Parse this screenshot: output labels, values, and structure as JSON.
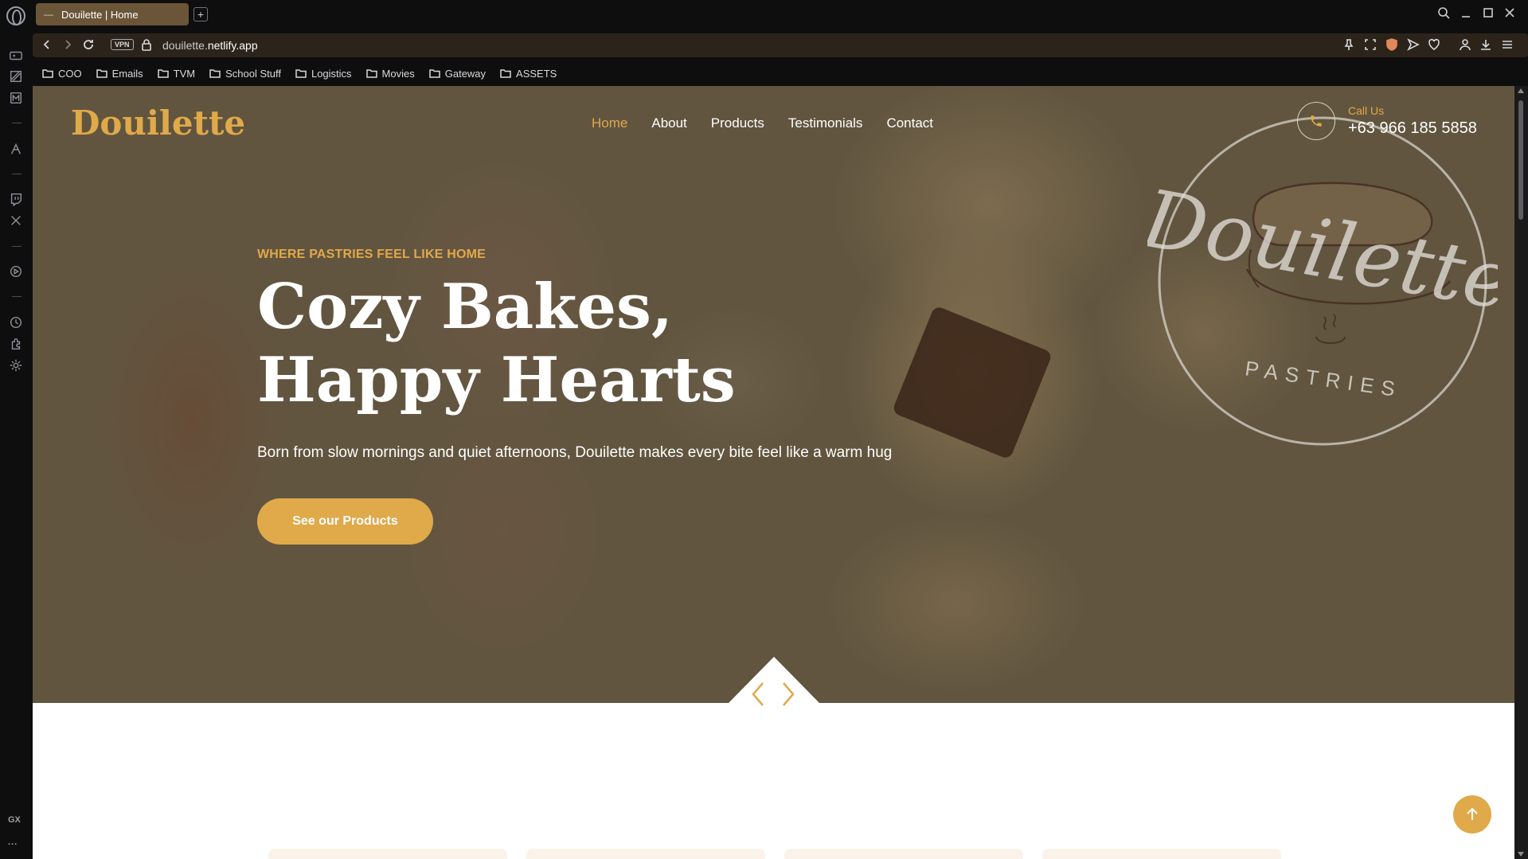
{
  "browser": {
    "tab_title": "Douilette | Home",
    "tab_icon": "dash-icon",
    "vpn_label": "VPN",
    "url_prefix": "douilette.",
    "url_domain": "netlify.app",
    "rail_label": "GX",
    "rail_more": "...",
    "bookmarks": [
      {
        "label": "COO"
      },
      {
        "label": "Emails"
      },
      {
        "label": "TVM"
      },
      {
        "label": "School Stuff"
      },
      {
        "label": "Logistics"
      },
      {
        "label": "Movies"
      },
      {
        "label": "Gateway"
      },
      {
        "label": "ASSETS"
      }
    ]
  },
  "site": {
    "logo": "Douilette",
    "nav": [
      {
        "label": "Home",
        "active": true
      },
      {
        "label": "About"
      },
      {
        "label": "Products"
      },
      {
        "label": "Testimonials"
      },
      {
        "label": "Contact"
      }
    ],
    "call_label": "Call Us",
    "call_number": "+63 966 185 5858",
    "badge_script": "Douilette",
    "badge_sub": "PASTRIES"
  },
  "hero": {
    "eyebrow": "WHERE PASTRIES FEEL LIKE HOME",
    "headline": "Cozy Bakes, Happy Hearts",
    "subtext": "Born from slow mornings and quiet afternoons, Douilette makes every bite feel like a warm hug",
    "cta": "See our Products"
  },
  "colors": {
    "accent": "#e0a94a",
    "tab": "#6b5538",
    "address_bar": "#2c241a"
  }
}
